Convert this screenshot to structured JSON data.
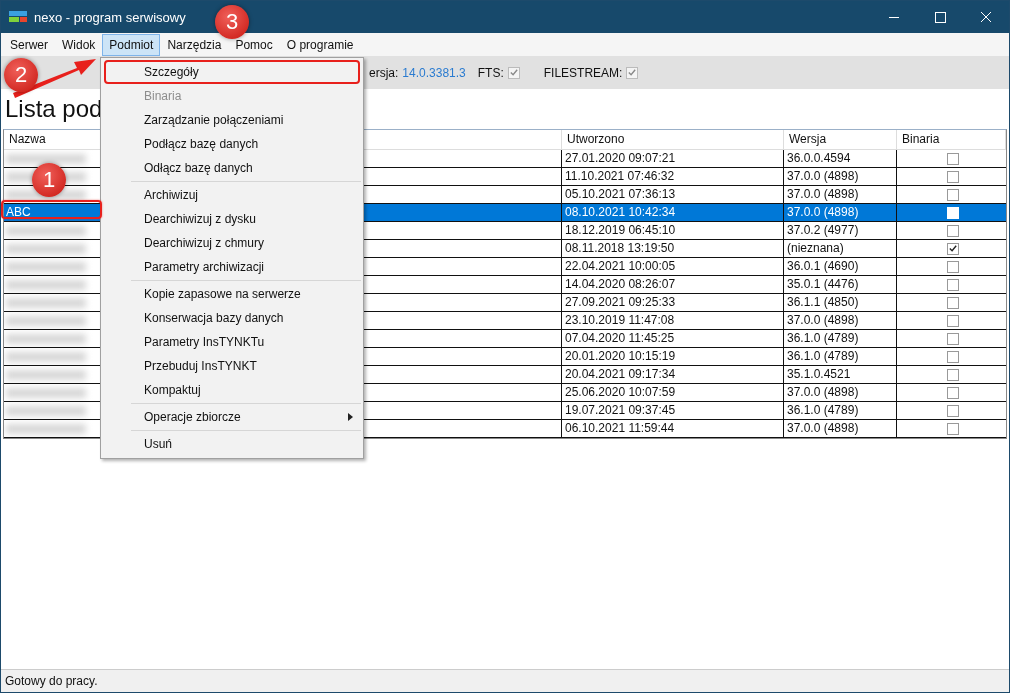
{
  "window": {
    "title": "nexo - program serwisowy"
  },
  "menu_bar": [
    {
      "label": "Serwer",
      "selected": false
    },
    {
      "label": "Widok",
      "selected": false
    },
    {
      "label": "Podmiot",
      "selected": true
    },
    {
      "label": "Narzędzia",
      "selected": false
    },
    {
      "label": "Pomoc",
      "selected": false
    },
    {
      "label": "O programie",
      "selected": false
    }
  ],
  "toolbar": {
    "version_label": "ersja:",
    "version_value": "14.0.3381.3",
    "fts": {
      "label": "FTS:",
      "checked": true
    },
    "filestream": {
      "label": "FILESTREAM:",
      "checked": true
    }
  },
  "heading": "Lista pod",
  "table": {
    "columns": [
      "Nazwa",
      "",
      "Utworzono",
      "Wersja",
      "Binaria"
    ],
    "rows": [
      {
        "selected": false,
        "created": "27.01.2020 09:07:21",
        "version": "36.0.0.4594",
        "binaria": false
      },
      {
        "selected": false,
        "created": "11.10.2021 07:46:32",
        "version": "37.0.0 (4898)",
        "binaria": false
      },
      {
        "selected": false,
        "created": "05.10.2021 07:36:13",
        "version": "37.0.0 (4898)",
        "binaria": false
      },
      {
        "name": "ABC",
        "selected": true,
        "created": "08.10.2021 10:42:34",
        "version": "37.0.0 (4898)",
        "binaria": false
      },
      {
        "selected": false,
        "created": "18.12.2019 06:45:10",
        "version": "37.0.2 (4977)",
        "binaria": false
      },
      {
        "selected": false,
        "created": "08.11.2018 13:19:50",
        "version": "(nieznana)",
        "binaria": true
      },
      {
        "selected": false,
        "created": "22.04.2021 10:00:05",
        "version": "36.0.1 (4690)",
        "binaria": false
      },
      {
        "selected": false,
        "created": "14.04.2020 08:26:07",
        "version": "35.0.1 (4476)",
        "binaria": false
      },
      {
        "selected": false,
        "created": "27.09.2021 09:25:33",
        "version": "36.1.1 (4850)",
        "binaria": false
      },
      {
        "selected": false,
        "created": "23.10.2019 11:47:08",
        "version": "37.0.0 (4898)",
        "binaria": false
      },
      {
        "selected": false,
        "created": "07.04.2020 11:45:25",
        "version": "36.1.0 (4789)",
        "binaria": false
      },
      {
        "selected": false,
        "created": "20.01.2020 10:15:19",
        "version": "36.1.0 (4789)",
        "binaria": false
      },
      {
        "selected": false,
        "created": "20.04.2021 09:17:34",
        "version": "35.1.0.4521",
        "binaria": false
      },
      {
        "selected": false,
        "created": "25.06.2020 10:07:59",
        "version": "37.0.0 (4898)",
        "binaria": false
      },
      {
        "selected": false,
        "created": "19.07.2021 09:37:45",
        "version": "36.1.0 (4789)",
        "binaria": false
      },
      {
        "selected": false,
        "created": "06.10.2021 11:59:44",
        "version": "37.0.0 (4898)",
        "binaria": false
      }
    ]
  },
  "dropdown_menu": [
    {
      "kind": "item",
      "label": "Szczegóły",
      "disabled": false,
      "highlighted": true
    },
    {
      "kind": "item",
      "label": "Binaria",
      "disabled": true
    },
    {
      "kind": "item",
      "label": "Zarządzanie połączeniami",
      "disabled": false
    },
    {
      "kind": "item",
      "label": "Podłącz bazę danych",
      "disabled": false
    },
    {
      "kind": "item",
      "label": "Odłącz bazę danych",
      "disabled": false
    },
    {
      "kind": "separator"
    },
    {
      "kind": "item",
      "label": "Archiwizuj",
      "disabled": false
    },
    {
      "kind": "item",
      "label": "Dearchiwizuj z dysku",
      "disabled": false
    },
    {
      "kind": "item",
      "label": "Dearchiwizuj z chmury",
      "disabled": false
    },
    {
      "kind": "item",
      "label": "Parametry archiwizacji",
      "disabled": false
    },
    {
      "kind": "separator"
    },
    {
      "kind": "item",
      "label": "Kopie zapasowe na serwerze",
      "disabled": false
    },
    {
      "kind": "item",
      "label": "Konserwacja bazy danych",
      "disabled": false
    },
    {
      "kind": "item",
      "label": "Parametry InsTYNKTu",
      "disabled": false
    },
    {
      "kind": "item",
      "label": "Przebuduj InsTYNKT",
      "disabled": false
    },
    {
      "kind": "item",
      "label": "Kompaktuj",
      "disabled": false
    },
    {
      "kind": "separator"
    },
    {
      "kind": "submenu",
      "label": "Operacje zbiorcze",
      "disabled": false
    },
    {
      "kind": "separator"
    },
    {
      "kind": "item",
      "label": "Usuń",
      "disabled": false
    }
  ],
  "annotations": [
    "1",
    "2",
    "3"
  ],
  "status_bar": "Gotowy do pracy."
}
